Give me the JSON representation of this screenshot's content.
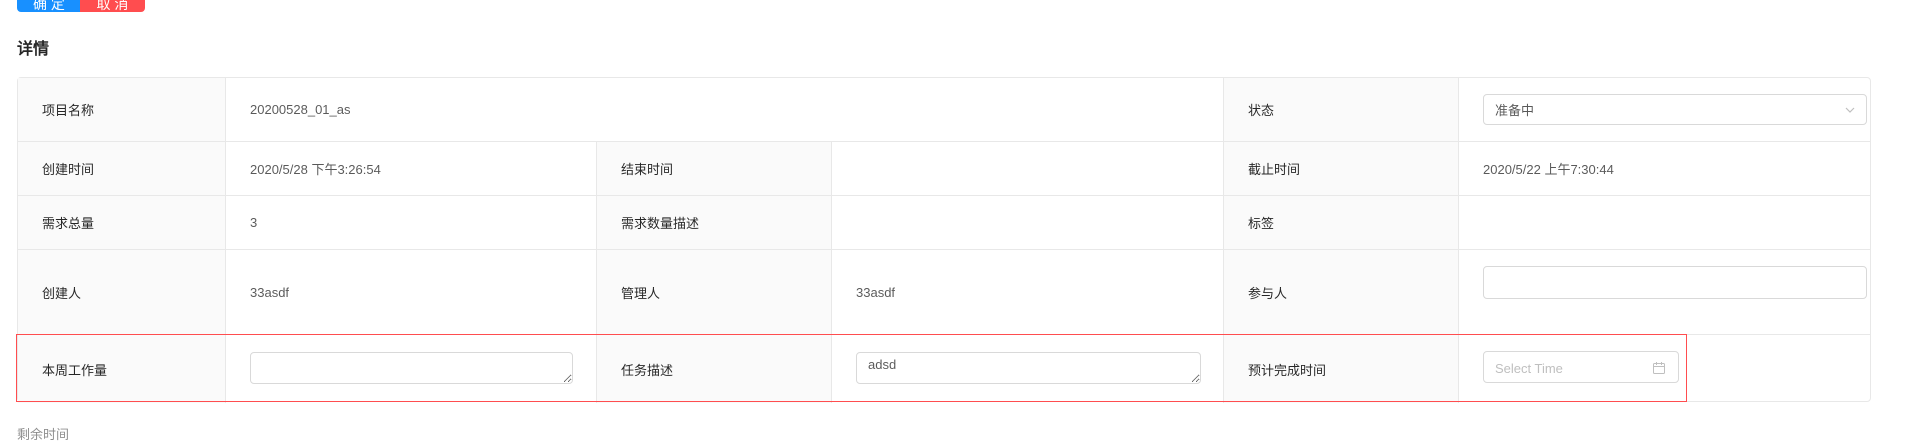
{
  "toolbar": {
    "confirm_label": "确 定",
    "cancel_label": "取 消"
  },
  "section_title": "详情",
  "details": {
    "project_name_label": "项目名称",
    "project_name_value": "20200528_01_as",
    "status_label": "状态",
    "status_value": "准备中",
    "created_time_label": "创建时间",
    "created_time_value": "2020/5/28 下午3:26:54",
    "end_time_label": "结束时间",
    "end_time_value": "",
    "deadline_label": "截止时间",
    "deadline_value": "2020/5/22 上午7:30:44",
    "demand_total_label": "需求总量",
    "demand_total_value": "3",
    "demand_desc_label": "需求数量描述",
    "demand_desc_value": "",
    "tags_label": "标签",
    "tags_value": "",
    "creator_label": "创建人",
    "creator_value": "33asdf",
    "manager_label": "管理人",
    "manager_value": "33asdf",
    "participants_label": "参与人",
    "participants_value": "",
    "weekly_workload_label": "本周工作量",
    "weekly_workload_value": "",
    "task_desc_label": "任务描述",
    "task_desc_value": "adsd",
    "expected_finish_label": "预计完成时间",
    "expected_finish_placeholder": "Select Time"
  },
  "footer": {
    "remaining_time_label": "剩余时间"
  },
  "colors": {
    "primary": "#1890ff",
    "danger": "#ff4d4f",
    "highlight_border": "#ff4d4f"
  },
  "icons": {
    "status_select": "chevron-down-icon",
    "date_picker": "calendar-icon"
  }
}
